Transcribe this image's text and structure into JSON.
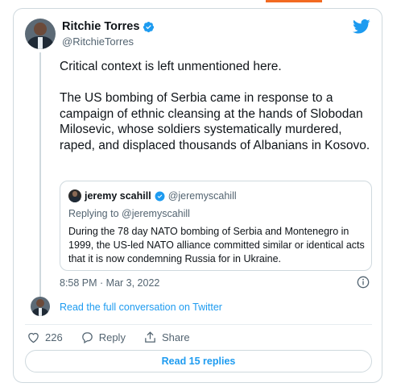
{
  "author": {
    "name": "Ritchie Torres",
    "handle": "@RitchieTorres"
  },
  "tweet": {
    "paragraphs": [
      "Critical context is left unmentioned here.",
      "The US bombing of Serbia came in response to a campaign of ethnic cleansing at the hands of Slobodan Milosevic, whose soldiers systematically murdered, raped, and displaced thousands of Albanians in Kosovo."
    ],
    "timestamp": "8:58 PM · Mar 3, 2022"
  },
  "quoted_tweet": {
    "name": "jeremy scahill",
    "handle": "@jeremyscahill",
    "replying_to": "Replying to @jeremyscahill",
    "text": "During the 78 day NATO bombing of Serbia and Montenegro in 1999, the US-led NATO alliance committed similar or identical acts that it is now condemning Russia for in Ukraine."
  },
  "links": {
    "full_conversation": "Read the full conversation on Twitter",
    "read_replies": "Read 15 replies"
  },
  "actions": {
    "like_count": "226",
    "reply_label": "Reply",
    "share_label": "Share"
  },
  "colors": {
    "twitter_blue": "#1d9bf0",
    "secondary_text": "#536471",
    "border": "#cfd9de",
    "accent_strip": "#f26a21"
  },
  "icons": [
    "verified-badge-icon",
    "twitter-bird-icon",
    "info-icon",
    "heart-icon",
    "reply-icon",
    "share-icon"
  ]
}
